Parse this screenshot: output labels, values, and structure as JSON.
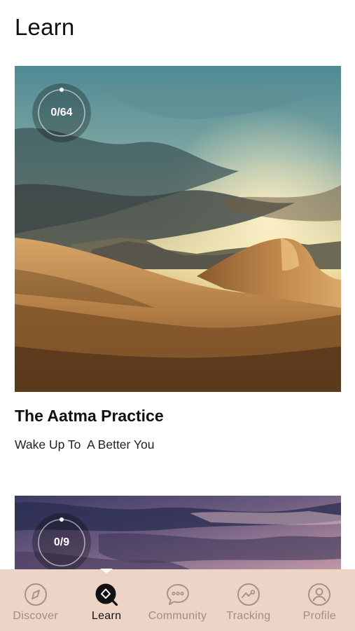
{
  "page": {
    "title": "Learn"
  },
  "courses": [
    {
      "title": "The Aatma Practice",
      "subtitle": "Wake Up To  A Better You",
      "progress_label": "0/64",
      "completed": 0,
      "total": 64,
      "image": "desert-dunes-at-dusk"
    },
    {
      "progress_label": "0/9",
      "completed": 0,
      "total": 9,
      "image": "purple-cloudy-sky"
    }
  ],
  "bottom_nav": {
    "active": "Learn",
    "background": "#ecd4c7",
    "items": [
      {
        "label": "Discover",
        "icon": "compass-icon"
      },
      {
        "label": "Learn",
        "icon": "search-diamond-icon"
      },
      {
        "label": "Community",
        "icon": "chat-bubble-icon"
      },
      {
        "label": "Tracking",
        "icon": "chart-line-icon"
      },
      {
        "label": "Profile",
        "icon": "user-icon"
      }
    ]
  }
}
